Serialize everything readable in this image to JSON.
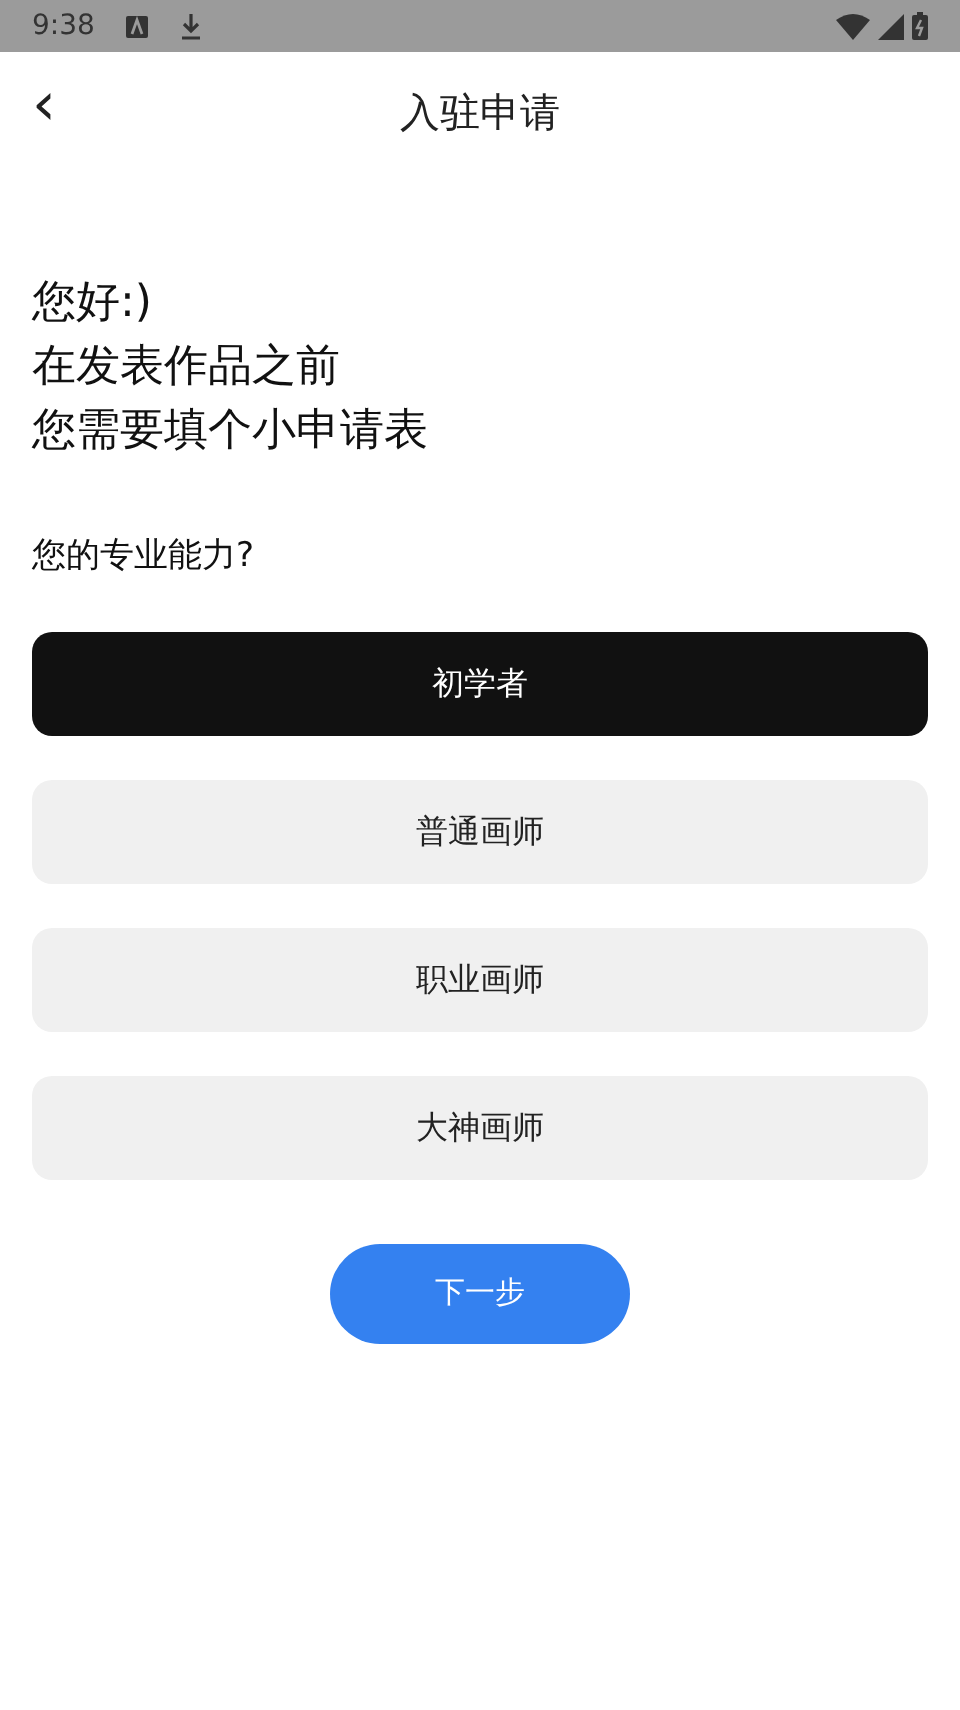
{
  "status_bar": {
    "time": "9:38"
  },
  "header": {
    "back": "‹",
    "title": "入驻申请"
  },
  "greeting": [
    "您好:)",
    "在发表作品之前",
    "您需要填个小申请表"
  ],
  "question": "您的专业能力?",
  "options": [
    {
      "label": "初学者",
      "selected": true
    },
    {
      "label": "普通画师",
      "selected": false
    },
    {
      "label": "职业画师",
      "selected": false
    },
    {
      "label": "大神画师",
      "selected": false
    }
  ],
  "next_button": "下一步"
}
